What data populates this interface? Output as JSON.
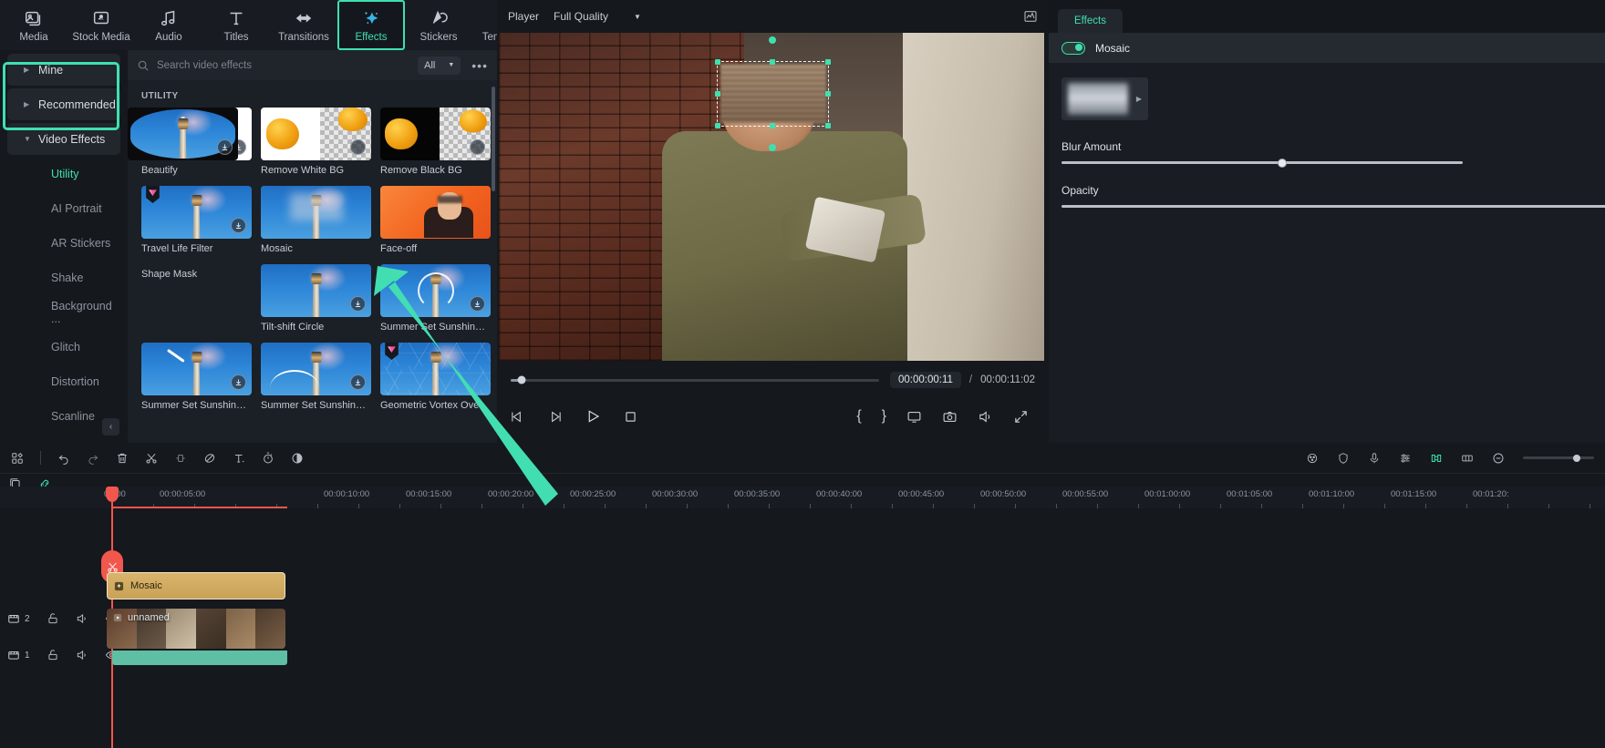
{
  "toolbar": {
    "items": [
      {
        "label": "Media",
        "icon": "media-icon"
      },
      {
        "label": "Stock Media",
        "icon": "stock-media-icon"
      },
      {
        "label": "Audio",
        "icon": "audio-note-icon"
      },
      {
        "label": "Titles",
        "icon": "titles-text-icon"
      },
      {
        "label": "Transitions",
        "icon": "transitions-arrows-icon"
      },
      {
        "label": "Effects",
        "icon": "effects-sparkle-icon",
        "active": true
      },
      {
        "label": "Stickers",
        "icon": "stickers-icon"
      },
      {
        "label": "Templates",
        "icon": "templates-grid-icon"
      }
    ]
  },
  "categories": {
    "items": [
      {
        "label": "Mine",
        "type": "group",
        "expanded": false
      },
      {
        "label": "Recommended",
        "type": "group",
        "expanded": false
      },
      {
        "label": "Video Effects",
        "type": "group",
        "expanded": true,
        "highlighted": true
      },
      {
        "label": "Utility",
        "type": "sub",
        "selected": true
      },
      {
        "label": "AI Portrait",
        "type": "sub"
      },
      {
        "label": "AR Stickers",
        "type": "sub"
      },
      {
        "label": "Shake",
        "type": "sub"
      },
      {
        "label": "Background ...",
        "type": "sub"
      },
      {
        "label": "Glitch",
        "type": "sub"
      },
      {
        "label": "Distortion",
        "type": "sub"
      },
      {
        "label": "Scanline",
        "type": "sub"
      }
    ],
    "collapse_icon": "chevron-left-icon"
  },
  "browser": {
    "search_placeholder": "Search video effects",
    "filter_label": "All",
    "more_label": "•••",
    "section_title": "UTILITY",
    "effects": [
      {
        "label": "Beautify",
        "art": "beautify",
        "download": true
      },
      {
        "label": "Remove White BG",
        "art": "remove-white",
        "download": true
      },
      {
        "label": "Remove Black BG",
        "art": "remove-black",
        "download": true
      },
      {
        "label": "Travel Life Filter",
        "art": "lighthouse",
        "download": true,
        "premium": true
      },
      {
        "label": "Mosaic",
        "art": "mosaic",
        "selected": true
      },
      {
        "label": "Face-off",
        "art": "faceoff"
      },
      {
        "label": "Shape Mask",
        "art": "shapemask",
        "download": true
      },
      {
        "label": "Tilt-shift Circle",
        "art": "tiltshift",
        "download": true
      },
      {
        "label": "Summer Set Sunshine ...",
        "art": "ring",
        "download": true
      },
      {
        "label": "Summer Set Sunshine ...",
        "art": "streak",
        "download": true
      },
      {
        "label": "Summer Set Sunshine ...",
        "art": "swoosh",
        "download": true
      },
      {
        "label": "Geometric Vortex Ove...",
        "art": "vortex",
        "premium": true
      }
    ]
  },
  "player": {
    "title": "Player",
    "quality_label": "Full Quality",
    "quality_caret": "chevron-down-icon",
    "snapshot_icon": "waveform-icon",
    "current_time": "00:00:00:11",
    "separator": "/",
    "total_time": "00:00:11:02",
    "controls_left": [
      {
        "name": "prev-frame-button",
        "icon": "step-back-icon"
      },
      {
        "name": "next-frame-button",
        "icon": "step-forward-icon"
      },
      {
        "name": "play-button",
        "icon": "play-icon"
      },
      {
        "name": "stop-button",
        "icon": "stop-icon"
      }
    ],
    "controls_right": [
      {
        "name": "mark-in-button",
        "icon": "brace-open-icon",
        "glyph": "{"
      },
      {
        "name": "mark-out-button",
        "icon": "brace-close-icon",
        "glyph": "}"
      },
      {
        "name": "pop-out-button",
        "icon": "monitor-icon"
      },
      {
        "name": "snapshot-button",
        "icon": "camera-icon"
      },
      {
        "name": "volume-button",
        "icon": "speaker-icon"
      },
      {
        "name": "fullscreen-button",
        "icon": "expand-icon"
      }
    ]
  },
  "right_panel": {
    "tab_label": "Effects",
    "effect_name": "Mosaic",
    "toggle_on": true,
    "preset_arrow": "caret-right-icon",
    "sliders": [
      {
        "label": "Blur Amount",
        "value_pct": 55
      },
      {
        "label": "Opacity",
        "value_pct": 100
      }
    ]
  },
  "timeline": {
    "toolbar_left": [
      {
        "name": "layout-button",
        "icon": "grid-layout-icon"
      },
      {
        "name": "separator",
        "icon": "divider"
      },
      {
        "name": "undo-button",
        "icon": "undo-icon"
      },
      {
        "name": "redo-button",
        "icon": "redo-icon"
      },
      {
        "name": "delete-button",
        "icon": "trash-icon"
      },
      {
        "name": "split-button",
        "icon": "scissors-icon"
      },
      {
        "name": "crop-button",
        "icon": "crop-icon"
      },
      {
        "name": "color-match-button",
        "icon": "no-color-icon"
      },
      {
        "name": "text-button",
        "icon": "text-t-icon"
      },
      {
        "name": "speed-button",
        "icon": "stopwatch-icon"
      },
      {
        "name": "mask-button",
        "icon": "circle-half-icon"
      }
    ],
    "toolbar_right": [
      {
        "name": "settings-button",
        "icon": "gear-dots-icon"
      },
      {
        "name": "shield-button",
        "icon": "shield-icon"
      },
      {
        "name": "mic-button",
        "icon": "microphone-icon"
      },
      {
        "name": "mixer-button",
        "icon": "mixer-icon"
      },
      {
        "name": "marker-button",
        "icon": "marker-icon",
        "accent": true
      },
      {
        "name": "fit-button",
        "icon": "fit-timeline-icon"
      },
      {
        "name": "zoom-out-button",
        "icon": "minus-circle-icon"
      },
      {
        "name": "zoom-slider",
        "icon": "zoom-slider"
      }
    ],
    "left_header": [
      {
        "name": "snapshot-track-button",
        "icon": "stack-icon"
      },
      {
        "name": "link-button",
        "icon": "link-icon",
        "accent": true
      }
    ],
    "ruler_ticks": [
      "00:00",
      "00:00:05:00",
      "00:00:10:00",
      "00:00:15:00",
      "00:00:20:00",
      "00:00:25:00",
      "00:00:30:00",
      "00:00:35:00",
      "00:00:40:00",
      "00:00:45:00",
      "00:00:50:00",
      "00:00:55:00",
      "00:01:00:00",
      "00:01:05:00",
      "00:01:10:00",
      "00:01:15:00",
      "00:01:20:"
    ],
    "tracks": [
      {
        "number": "2",
        "type": "effect",
        "clip_label": "Mosaic",
        "clip_icon": "effect-badge-icon",
        "controls": [
          {
            "name": "track-type-icon",
            "icon": "film-icon"
          },
          {
            "name": "lock-button",
            "icon": "unlock-icon"
          },
          {
            "name": "mute-button",
            "icon": "speaker-icon"
          },
          {
            "name": "visibility-button",
            "icon": "eye-icon"
          }
        ]
      },
      {
        "number": "1",
        "type": "video",
        "clip_label": "unnamed",
        "clip_icon": "play-badge-icon",
        "controls": [
          {
            "name": "track-type-icon",
            "icon": "film-icon"
          },
          {
            "name": "lock-button",
            "icon": "unlock-icon"
          },
          {
            "name": "mute-button",
            "icon": "speaker-icon"
          },
          {
            "name": "visibility-button",
            "icon": "eye-icon"
          }
        ]
      }
    ],
    "playhead_icon": "split-scissors-icon"
  },
  "colors": {
    "accent": "#3ee0b0",
    "playhead": "#f2574d",
    "clip_effect": "#d9b46b",
    "audio_wave": "#5fbfa4",
    "panel_bg": "#1b1f26",
    "app_bg": "#15181d"
  }
}
